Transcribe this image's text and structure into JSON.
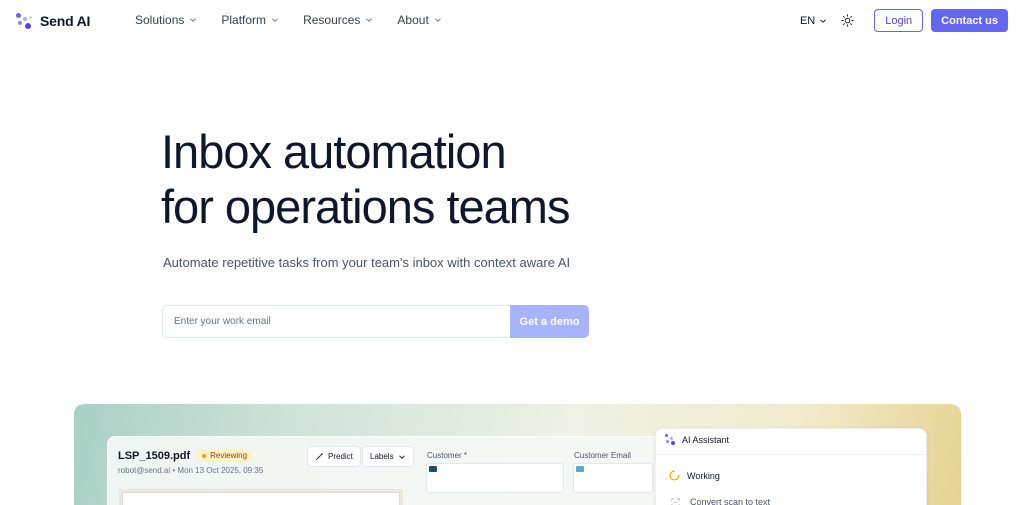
{
  "nav": {
    "logo_text": "Send AI",
    "menu": [
      {
        "label": "Solutions"
      },
      {
        "label": "Platform"
      },
      {
        "label": "Resources"
      },
      {
        "label": "About"
      }
    ],
    "language": "EN",
    "login_label": "Login",
    "contact_label": "Contact us"
  },
  "hero": {
    "title_line1": "Inbox automation",
    "title_line2": "for operations teams",
    "subtitle": "Automate repetitive tasks from your team's inbox with context aware AI",
    "email_placeholder": "Enter your work email",
    "cta_label": "Get a demo"
  },
  "demo": {
    "document": {
      "name": "LSP_1509.pdf",
      "status": "Reviewing",
      "meta": "robot@send.ai • Mon 13 Oct 2025, 09:35",
      "predict_label": "Predict",
      "labels_label": "Labels"
    },
    "fields": [
      {
        "label": "Customer *",
        "color": "#1e4e6b"
      },
      {
        "label": "Customer Email",
        "color": "#5fa8d3"
      }
    ],
    "assistant": {
      "title": "AI Assistant",
      "status": "Working",
      "task": "Convert scan to text"
    }
  },
  "colors": {
    "brand": "#6366f1",
    "cta_disabled": "#a5b4fc",
    "text_dark": "#0f172a",
    "badge_bg": "#fef3c7"
  }
}
